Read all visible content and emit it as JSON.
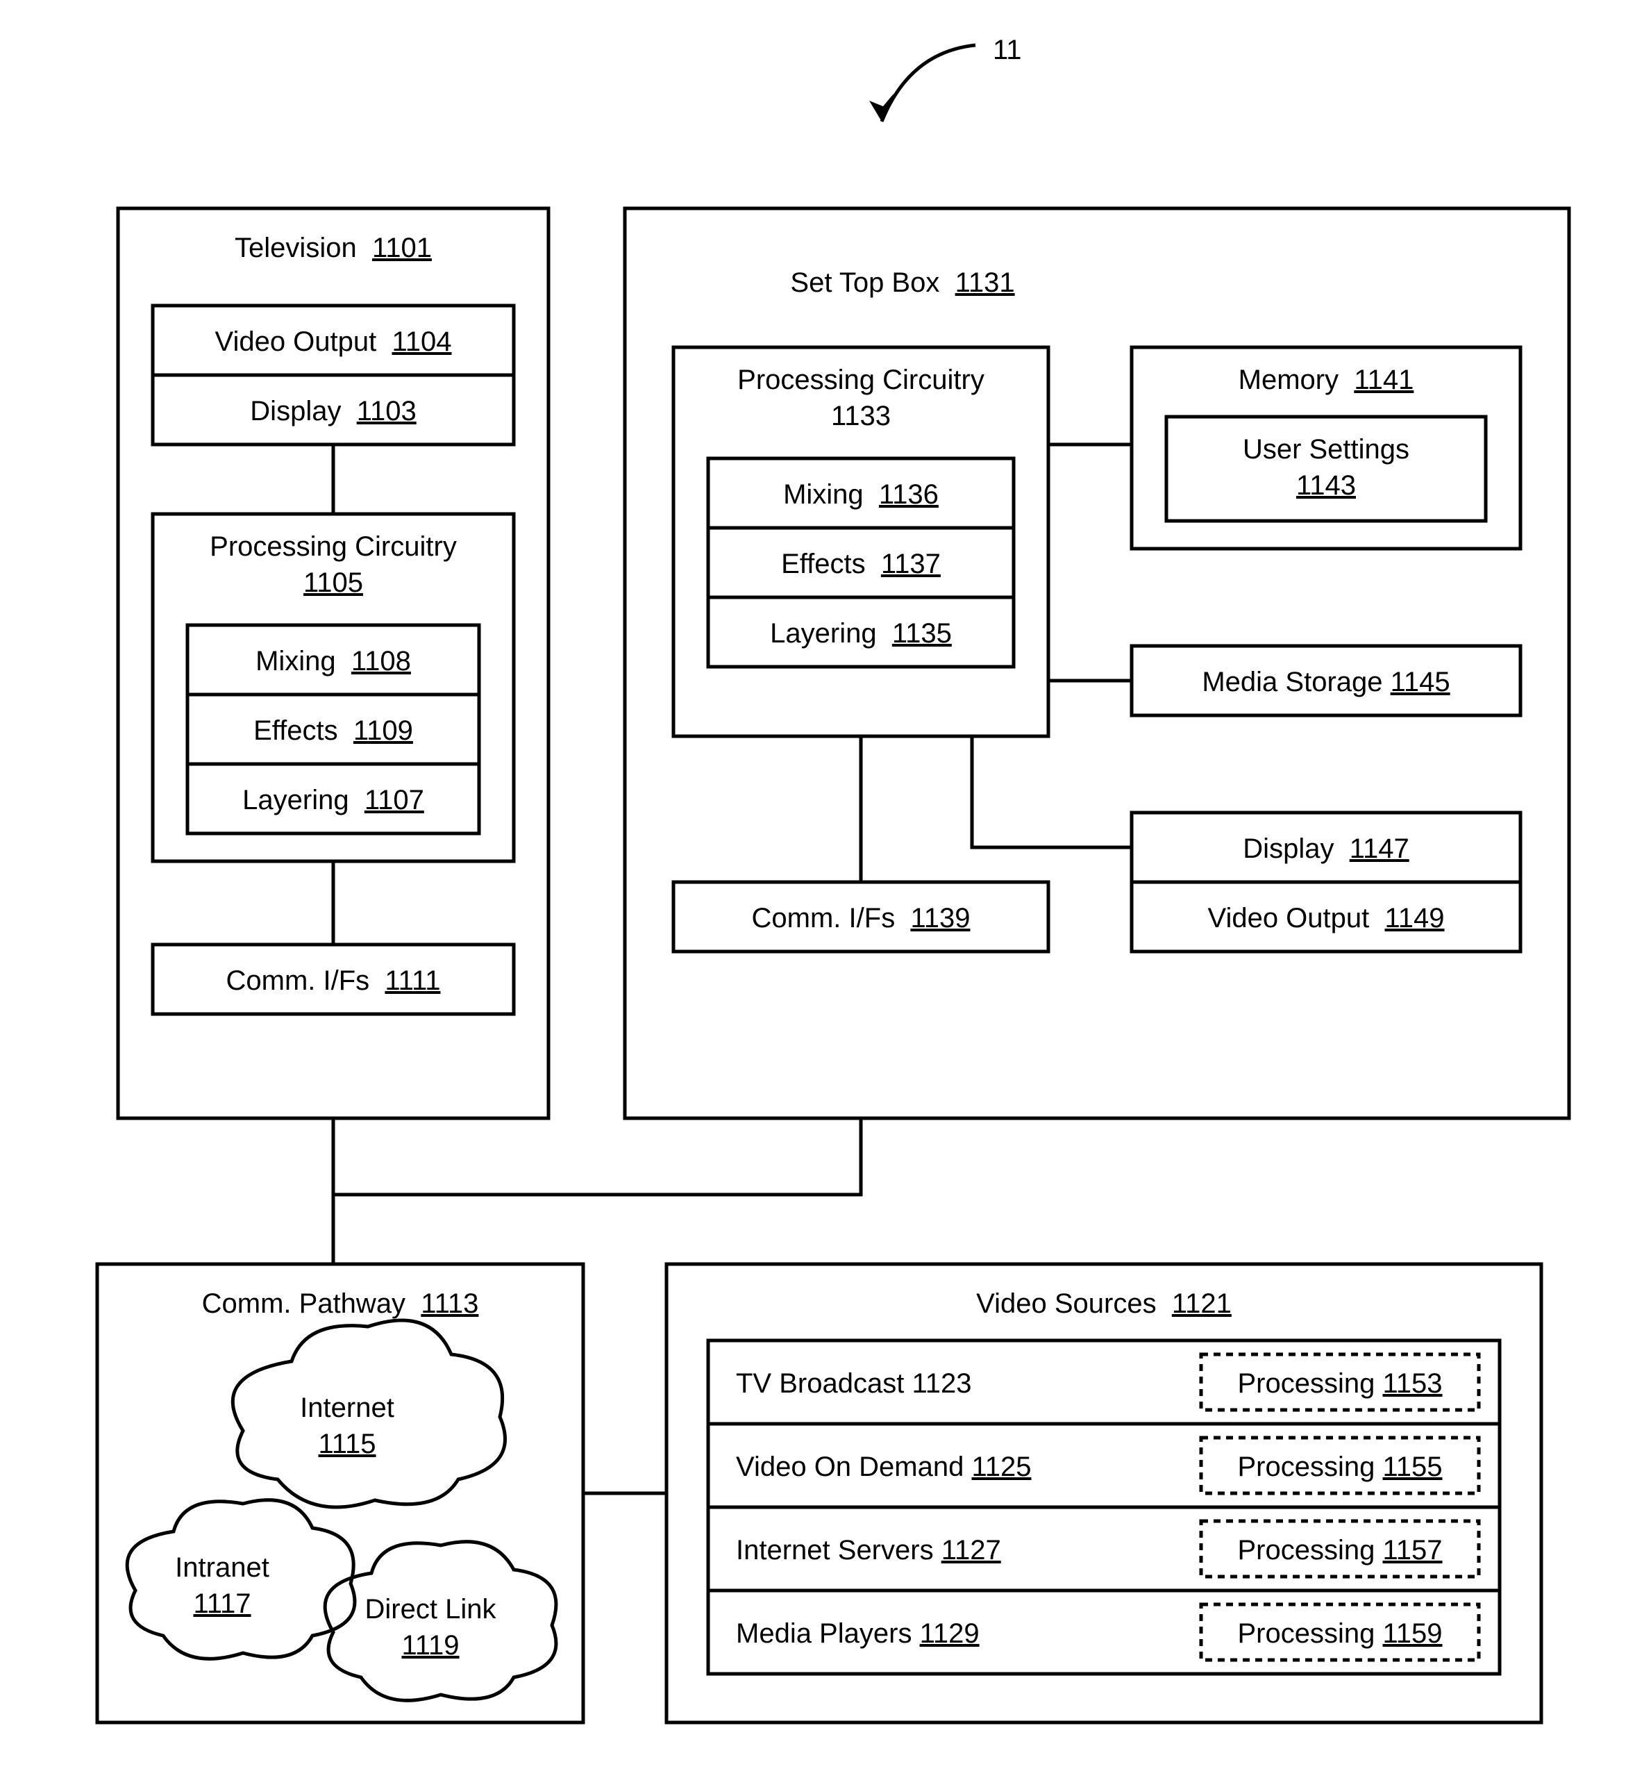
{
  "figure_ref": "11",
  "tv": {
    "title": "Television",
    "ref": "1101",
    "video_output": {
      "label": "Video Output",
      "ref": "1104"
    },
    "display": {
      "label": "Display",
      "ref": "1103"
    },
    "processing": {
      "title": "Processing Circuitry",
      "ref": "1105",
      "mixing": {
        "label": "Mixing",
        "ref": "1108"
      },
      "effects": {
        "label": "Effects",
        "ref": "1109"
      },
      "layering": {
        "label": "Layering",
        "ref": "1107"
      }
    },
    "comm_ifs": {
      "label": "Comm. I/Fs",
      "ref": "1111"
    }
  },
  "stb": {
    "title": "Set Top Box",
    "ref": "1131",
    "processing": {
      "title": "Processing Circuitry",
      "ref": "1133",
      "mixing": {
        "label": "Mixing",
        "ref": "1136"
      },
      "effects": {
        "label": "Effects",
        "ref": "1137"
      },
      "layering": {
        "label": "Layering",
        "ref": "1135"
      }
    },
    "memory": {
      "title": "Memory",
      "ref": "1141",
      "user_settings": {
        "label": "User Settings",
        "ref": "1143"
      }
    },
    "media_storage": {
      "label": "Media Storage",
      "ref": "1145"
    },
    "display": {
      "label": "Display",
      "ref": "1147"
    },
    "video_output": {
      "label": "Video Output",
      "ref": "1149"
    },
    "comm_ifs": {
      "label": "Comm. I/Fs",
      "ref": "1139"
    }
  },
  "pathway": {
    "title": "Comm. Pathway",
    "ref": "1113",
    "internet": {
      "label": "Internet",
      "ref": "1115"
    },
    "intranet": {
      "label": "Intranet",
      "ref": "1117"
    },
    "direct_link": {
      "label": "Direct Link",
      "ref": "1119"
    }
  },
  "sources": {
    "title": "Video Sources",
    "ref": "1121",
    "rows": [
      {
        "label": "TV Broadcast",
        "label_ref": "1123",
        "proc": "Processing",
        "proc_ref": "1153"
      },
      {
        "label": "Video On Demand",
        "label_ref": "1125",
        "proc": "Processing",
        "proc_ref": "1155"
      },
      {
        "label": "Internet Servers",
        "label_ref": "1127",
        "proc": "Processing",
        "proc_ref": "1157"
      },
      {
        "label": "Media Players",
        "label_ref": "1129",
        "proc": "Processing",
        "proc_ref": "1159"
      }
    ]
  }
}
